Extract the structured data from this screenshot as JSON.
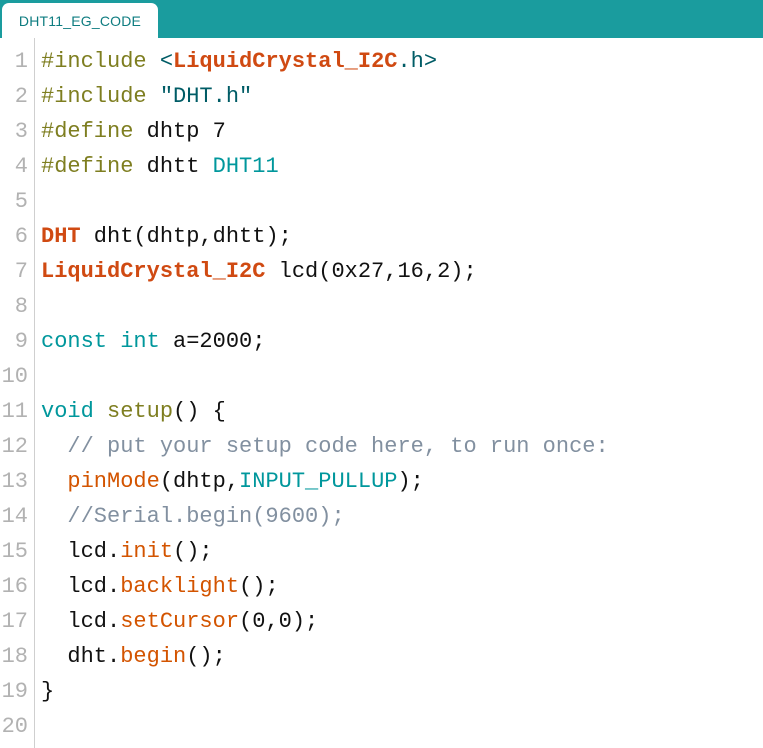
{
  "window": {
    "tab_bar_color": "#1A9C9E",
    "background": "#ffffff"
  },
  "tabs": [
    {
      "label": "DHT11_EG_CODE",
      "active": true
    }
  ],
  "editor": {
    "language": "Arduino C++",
    "gutter_color": "#b2b2b2",
    "colors": {
      "preprocessor": "#7E7E20",
      "type": "#D04A12",
      "function": "#D35400",
      "keyword": "#00979C",
      "constant": "#00979C",
      "string": "#005C66",
      "comment": "#8290A0",
      "plain": "#111111"
    },
    "lines": [
      {
        "n": "1",
        "text": "#include <LiquidCrystal_I2C.h>"
      },
      {
        "n": "2",
        "text": "#include \"DHT.h\""
      },
      {
        "n": "3",
        "text": "#define dhtp 7"
      },
      {
        "n": "4",
        "text": "#define dhtt DHT11"
      },
      {
        "n": "5",
        "text": ""
      },
      {
        "n": "6",
        "text": "DHT dht(dhtp,dhtt);"
      },
      {
        "n": "7",
        "text": "LiquidCrystal_I2C lcd(0x27,16,2);"
      },
      {
        "n": "8",
        "text": ""
      },
      {
        "n": "9",
        "text": "const int a=2000;"
      },
      {
        "n": "10",
        "text": ""
      },
      {
        "n": "11",
        "text": "void setup() {"
      },
      {
        "n": "12",
        "text": "  // put your setup code here, to run once:"
      },
      {
        "n": "13",
        "text": "  pinMode(dhtp,INPUT_PULLUP);"
      },
      {
        "n": "14",
        "text": "  //Serial.begin(9600);"
      },
      {
        "n": "15",
        "text": "  lcd.init();"
      },
      {
        "n": "16",
        "text": "  lcd.backlight();"
      },
      {
        "n": "17",
        "text": "  lcd.setCursor(0,0);"
      },
      {
        "n": "18",
        "text": "  dht.begin();"
      },
      {
        "n": "19",
        "text": "}"
      },
      {
        "n": "20",
        "text": ""
      }
    ],
    "tokens": {
      "l1": {
        "a": "#include ",
        "b": "<",
        "c": "LiquidCrystal_I2C",
        "d": ".h>"
      },
      "l2": {
        "a": "#include ",
        "b": "\"DHT.h\""
      },
      "l3": {
        "a": "#define ",
        "b": "dhtp 7"
      },
      "l4": {
        "a": "#define ",
        "b": "dhtt ",
        "c": "DHT11"
      },
      "l6": {
        "a": "DHT",
        "b": " dht(dhtp,dhtt);"
      },
      "l7": {
        "a": "LiquidCrystal_I2C",
        "b": " lcd(0x27,16,2);"
      },
      "l9": {
        "a": "const int",
        "b": " a=2000;"
      },
      "l11": {
        "a": "void",
        "b": " ",
        "c": "setup",
        "d": "() {"
      },
      "l12": {
        "a": "  // put your setup code here, to run once:"
      },
      "l13": {
        "a": "  ",
        "b": "pinMode",
        "c": "(dhtp,",
        "d": "INPUT_PULLUP",
        "e": ");"
      },
      "l14": {
        "a": "  //Serial.begin(9600);"
      },
      "l15": {
        "a": "  lcd.",
        "b": "init",
        "c": "();"
      },
      "l16": {
        "a": "  lcd.",
        "b": "backlight",
        "c": "();"
      },
      "l17": {
        "a": "  lcd.",
        "b": "setCursor",
        "c": "(0,0);"
      },
      "l18": {
        "a": "  dht.",
        "b": "begin",
        "c": "();"
      },
      "l19": {
        "a": "}"
      }
    }
  }
}
